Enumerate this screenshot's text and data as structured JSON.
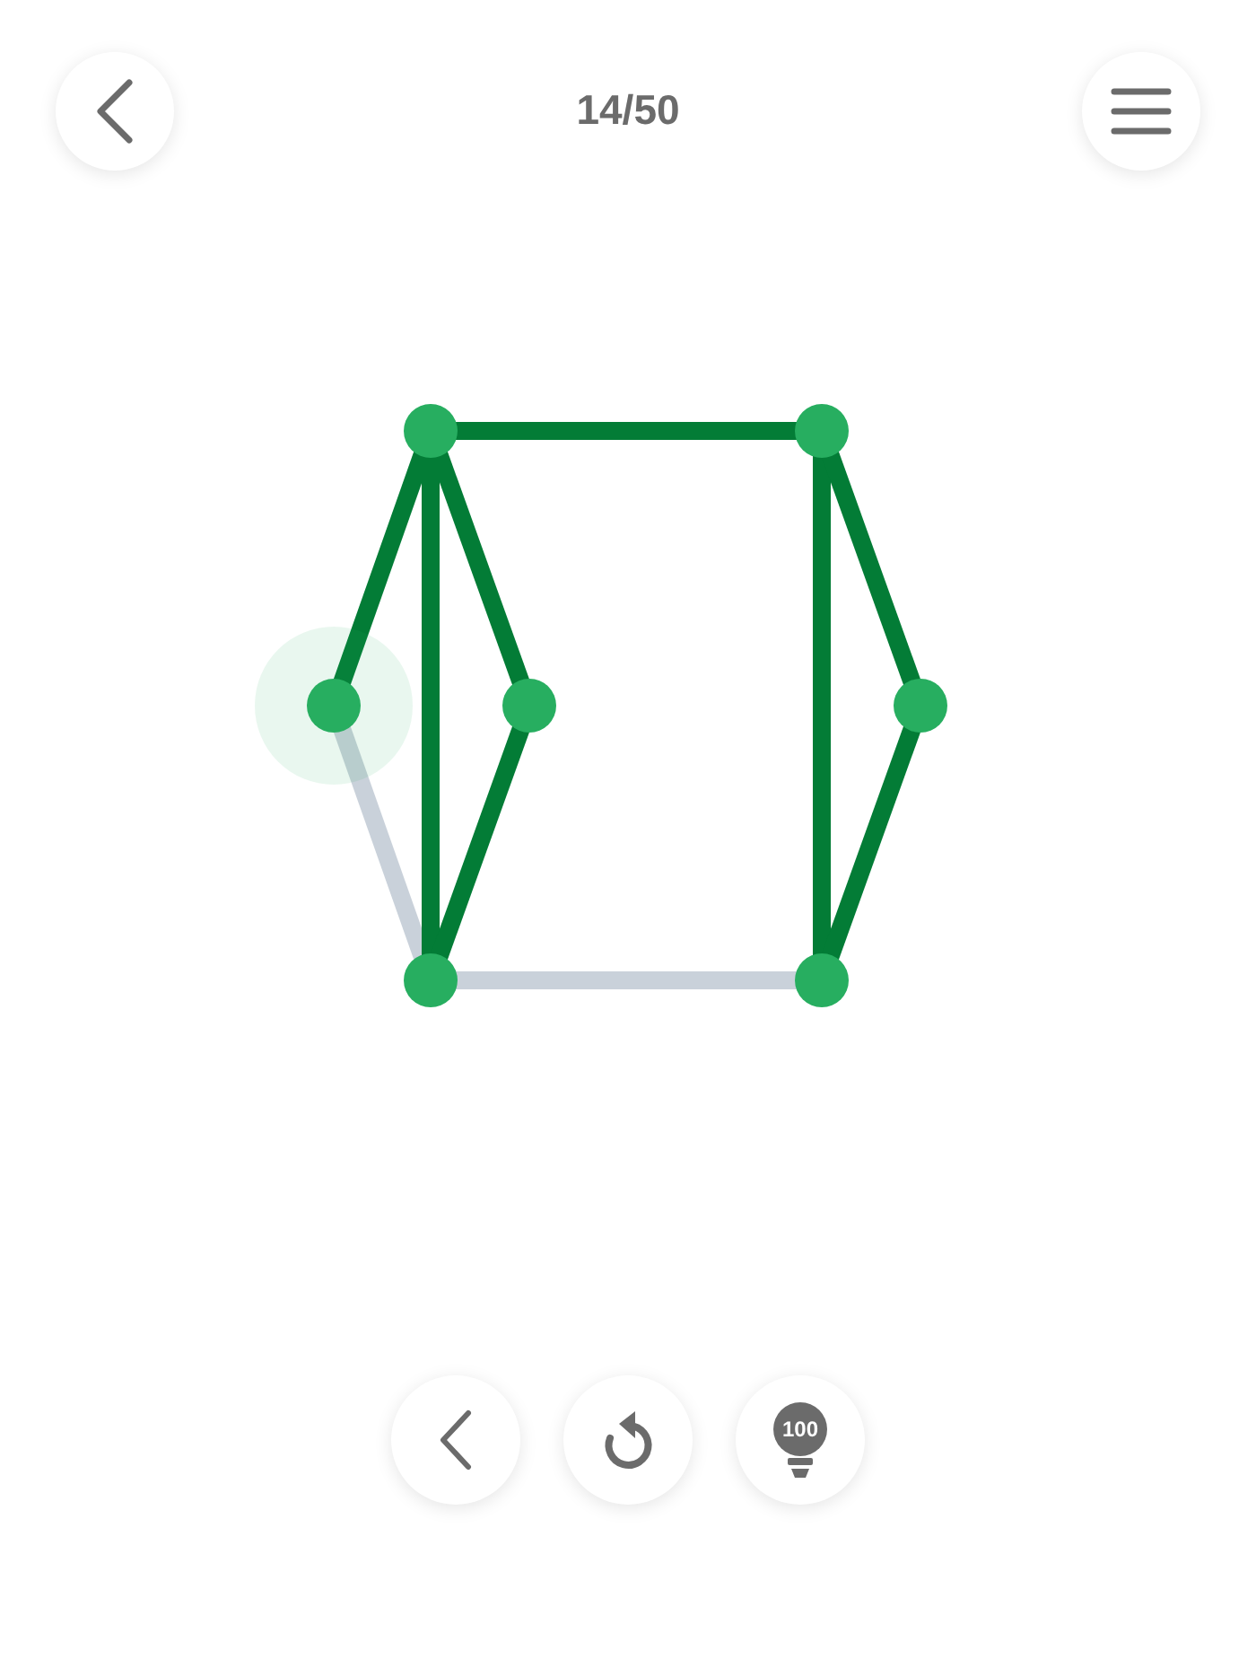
{
  "header": {
    "progress": "14/50"
  },
  "puzzle": {
    "nodes": [
      {
        "selected": false
      },
      {
        "selected": false
      },
      {
        "selected": true
      },
      {
        "selected": false
      },
      {
        "selected": false
      },
      {
        "selected": false
      },
      {
        "selected": false
      }
    ],
    "edges": [
      {
        "drawn": true
      },
      {
        "drawn": true
      },
      {
        "drawn": true
      },
      {
        "drawn": true
      },
      {
        "drawn": true
      },
      {
        "drawn": true
      },
      {
        "drawn": true
      },
      {
        "drawn": true
      },
      {
        "drawn": false
      },
      {
        "drawn": false
      }
    ]
  },
  "controls": {
    "hint_count": "100"
  }
}
